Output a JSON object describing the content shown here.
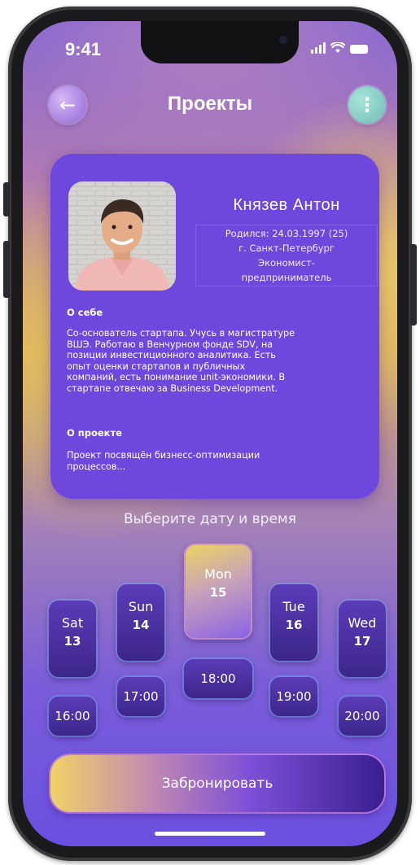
{
  "status_bar": {
    "time": "9:41"
  },
  "header": {
    "title": "Проекты",
    "back_icon": "←",
    "menu_icon": "⋮"
  },
  "profile": {
    "name": "Князев Антон",
    "details": [
      "Родился: 24.03.1997 (25)",
      "г. Санкт-Петербург",
      "Экономист-",
      "предприниматель"
    ],
    "about_heading": "О себе",
    "about_lines": [
      "Со-основатель стартапа. Учусь в магистратуре",
      "ВШЭ. Работаю в Венчурном фонде SDV, на",
      "позиции инвестиционного аналитика. Есть",
      "опыт оценки стартапов и публичных",
      "компаний, есть понимание unit-экономики. В",
      "стартапе отвечаю за Business Development."
    ],
    "project_heading": "О проекте",
    "project_lines": [
      "Проект посвящён бизнесс-оптимизации",
      "процессов..."
    ]
  },
  "schedule": {
    "label": "Выберите дату и время",
    "days": [
      {
        "name": "Sat",
        "num": "13",
        "time": "16:00"
      },
      {
        "name": "Sun",
        "num": "14",
        "time": "17:00"
      },
      {
        "name": "Mon",
        "num": "15",
        "time": "18:00",
        "selected": true
      },
      {
        "name": "Tue",
        "num": "16",
        "time": "19:00"
      },
      {
        "name": "Wed",
        "num": "17",
        "time": "20:00"
      }
    ]
  },
  "book_button": {
    "label": "Забронировать"
  },
  "colors": {
    "card": "#6e48dd",
    "accent_yellow": "#f0d367",
    "day_card": "#4a30a2"
  }
}
